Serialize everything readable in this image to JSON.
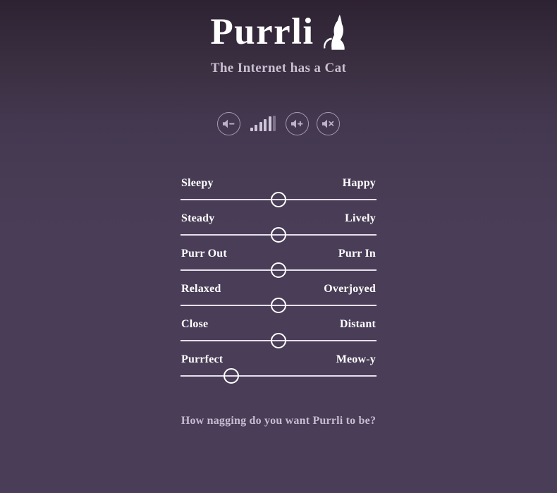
{
  "header": {
    "title": "Purrli",
    "tagline": "The Internet has a Cat",
    "logo_icon": "cat-silhouette-icon"
  },
  "player": {
    "volume_down": {
      "icon": "speaker-minus-icon",
      "label": "Volume down"
    },
    "volume_meter": {
      "icon": "volume-level-icon",
      "bars": 6,
      "active_bars": 5,
      "label": "Volume level"
    },
    "volume_up": {
      "icon": "speaker-plus-icon",
      "label": "Volume up"
    },
    "mute": {
      "icon": "speaker-mute-icon",
      "label": "Mute"
    }
  },
  "sliders": [
    {
      "name": "mood",
      "left_label": "Sleepy",
      "right_label": "Happy",
      "value_percent": 50
    },
    {
      "name": "pace",
      "left_label": "Steady",
      "right_label": "Lively",
      "value_percent": 50
    },
    {
      "name": "purr",
      "left_label": "Purr Out",
      "right_label": "Purr In",
      "value_percent": 50
    },
    {
      "name": "intensity",
      "left_label": "Relaxed",
      "right_label": "Overjoyed",
      "value_percent": 50
    },
    {
      "name": "distance",
      "left_label": "Close",
      "right_label": "Distant",
      "value_percent": 50
    },
    {
      "name": "meow",
      "left_label": "Purrfect",
      "right_label": "Meow-y",
      "value_percent": 26
    }
  ],
  "footer": {
    "nag_question": "How nagging do you want Purrli to be?"
  },
  "colors": {
    "background_top": "#2d2232",
    "background_bottom": "#4a3d57",
    "text_primary": "#ffffff",
    "text_muted": "#c6bcd1",
    "control_outline": "#a79bb4",
    "track": "#e6e0ec"
  }
}
